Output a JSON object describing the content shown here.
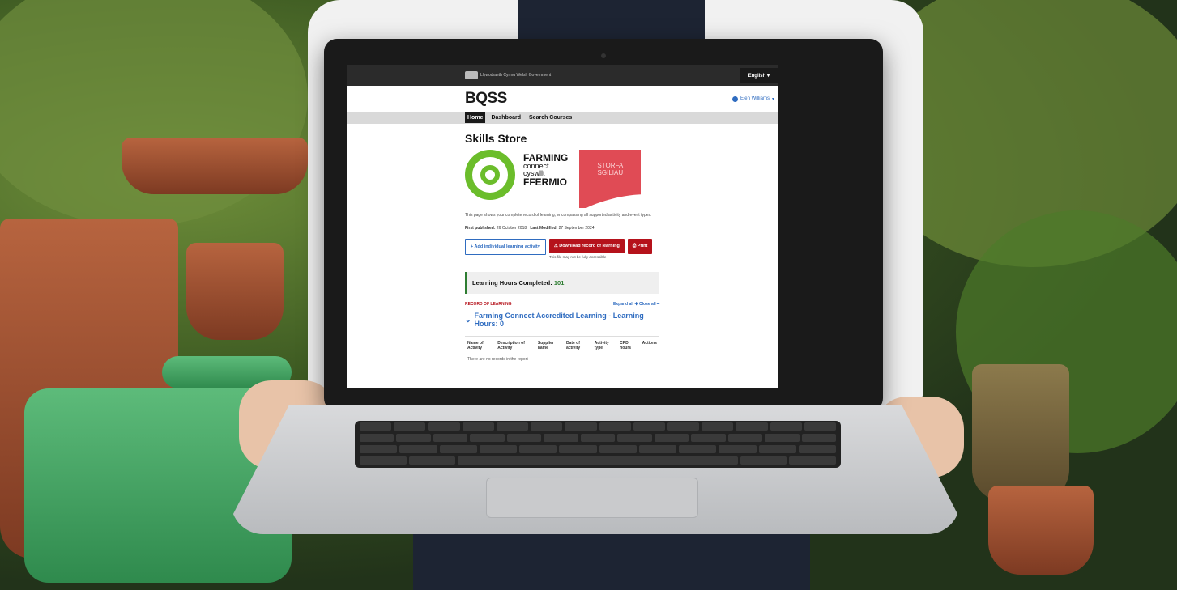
{
  "topbar": {
    "gov_logo_text": "Llywodraeth Cymru Welsh Government",
    "language_button": "English",
    "language_caret": "▾"
  },
  "header": {
    "brand": "BQSS",
    "user_name": "Elen Williams",
    "user_caret": "▾"
  },
  "nav": {
    "items": [
      "Home",
      "Dashboard",
      "Search Courses"
    ],
    "active": "Home"
  },
  "page": {
    "title": "Skills Store",
    "farming_connect": {
      "line1": "FARMING",
      "line2": "connect",
      "line3": "cyswllt",
      "line4": "FFERMIO"
    },
    "storfa": {
      "line1": "STORFA",
      "line2": "SGILIAU"
    },
    "description": "This page shows your complete record of learning, encompassing all supported activity and event types.",
    "first_published_label": "First published:",
    "first_published_value": "26 October 2018",
    "last_modified_label": "Last Modified:",
    "last_modified_value": "27 September 2024",
    "buttons": {
      "add": "+ Add individual learning activity",
      "download": "⚠ Download record of learning",
      "print": "⎙ Print"
    },
    "download_note": "This file may not be fully accessible",
    "hours_label": "Learning Hours Completed:",
    "hours_value": "101",
    "record_label": "RECORD OF LEARNING",
    "expand_label": "Expand all ✚ Close all ━",
    "section_title": "Farming Connect Accredited Learning - Learning Hours: 0",
    "section_chevron": "⌄",
    "table_headers": [
      "Name of Activity",
      "Description of Activity",
      "Supplier name",
      "Date of activity",
      "Activity type",
      "CPD hours",
      "Actions"
    ],
    "empty_text": "There are no records in the report"
  },
  "colors": {
    "accent_blue": "#2f6cc0",
    "accent_red": "#b5121b",
    "accent_green": "#6bbd2b"
  }
}
